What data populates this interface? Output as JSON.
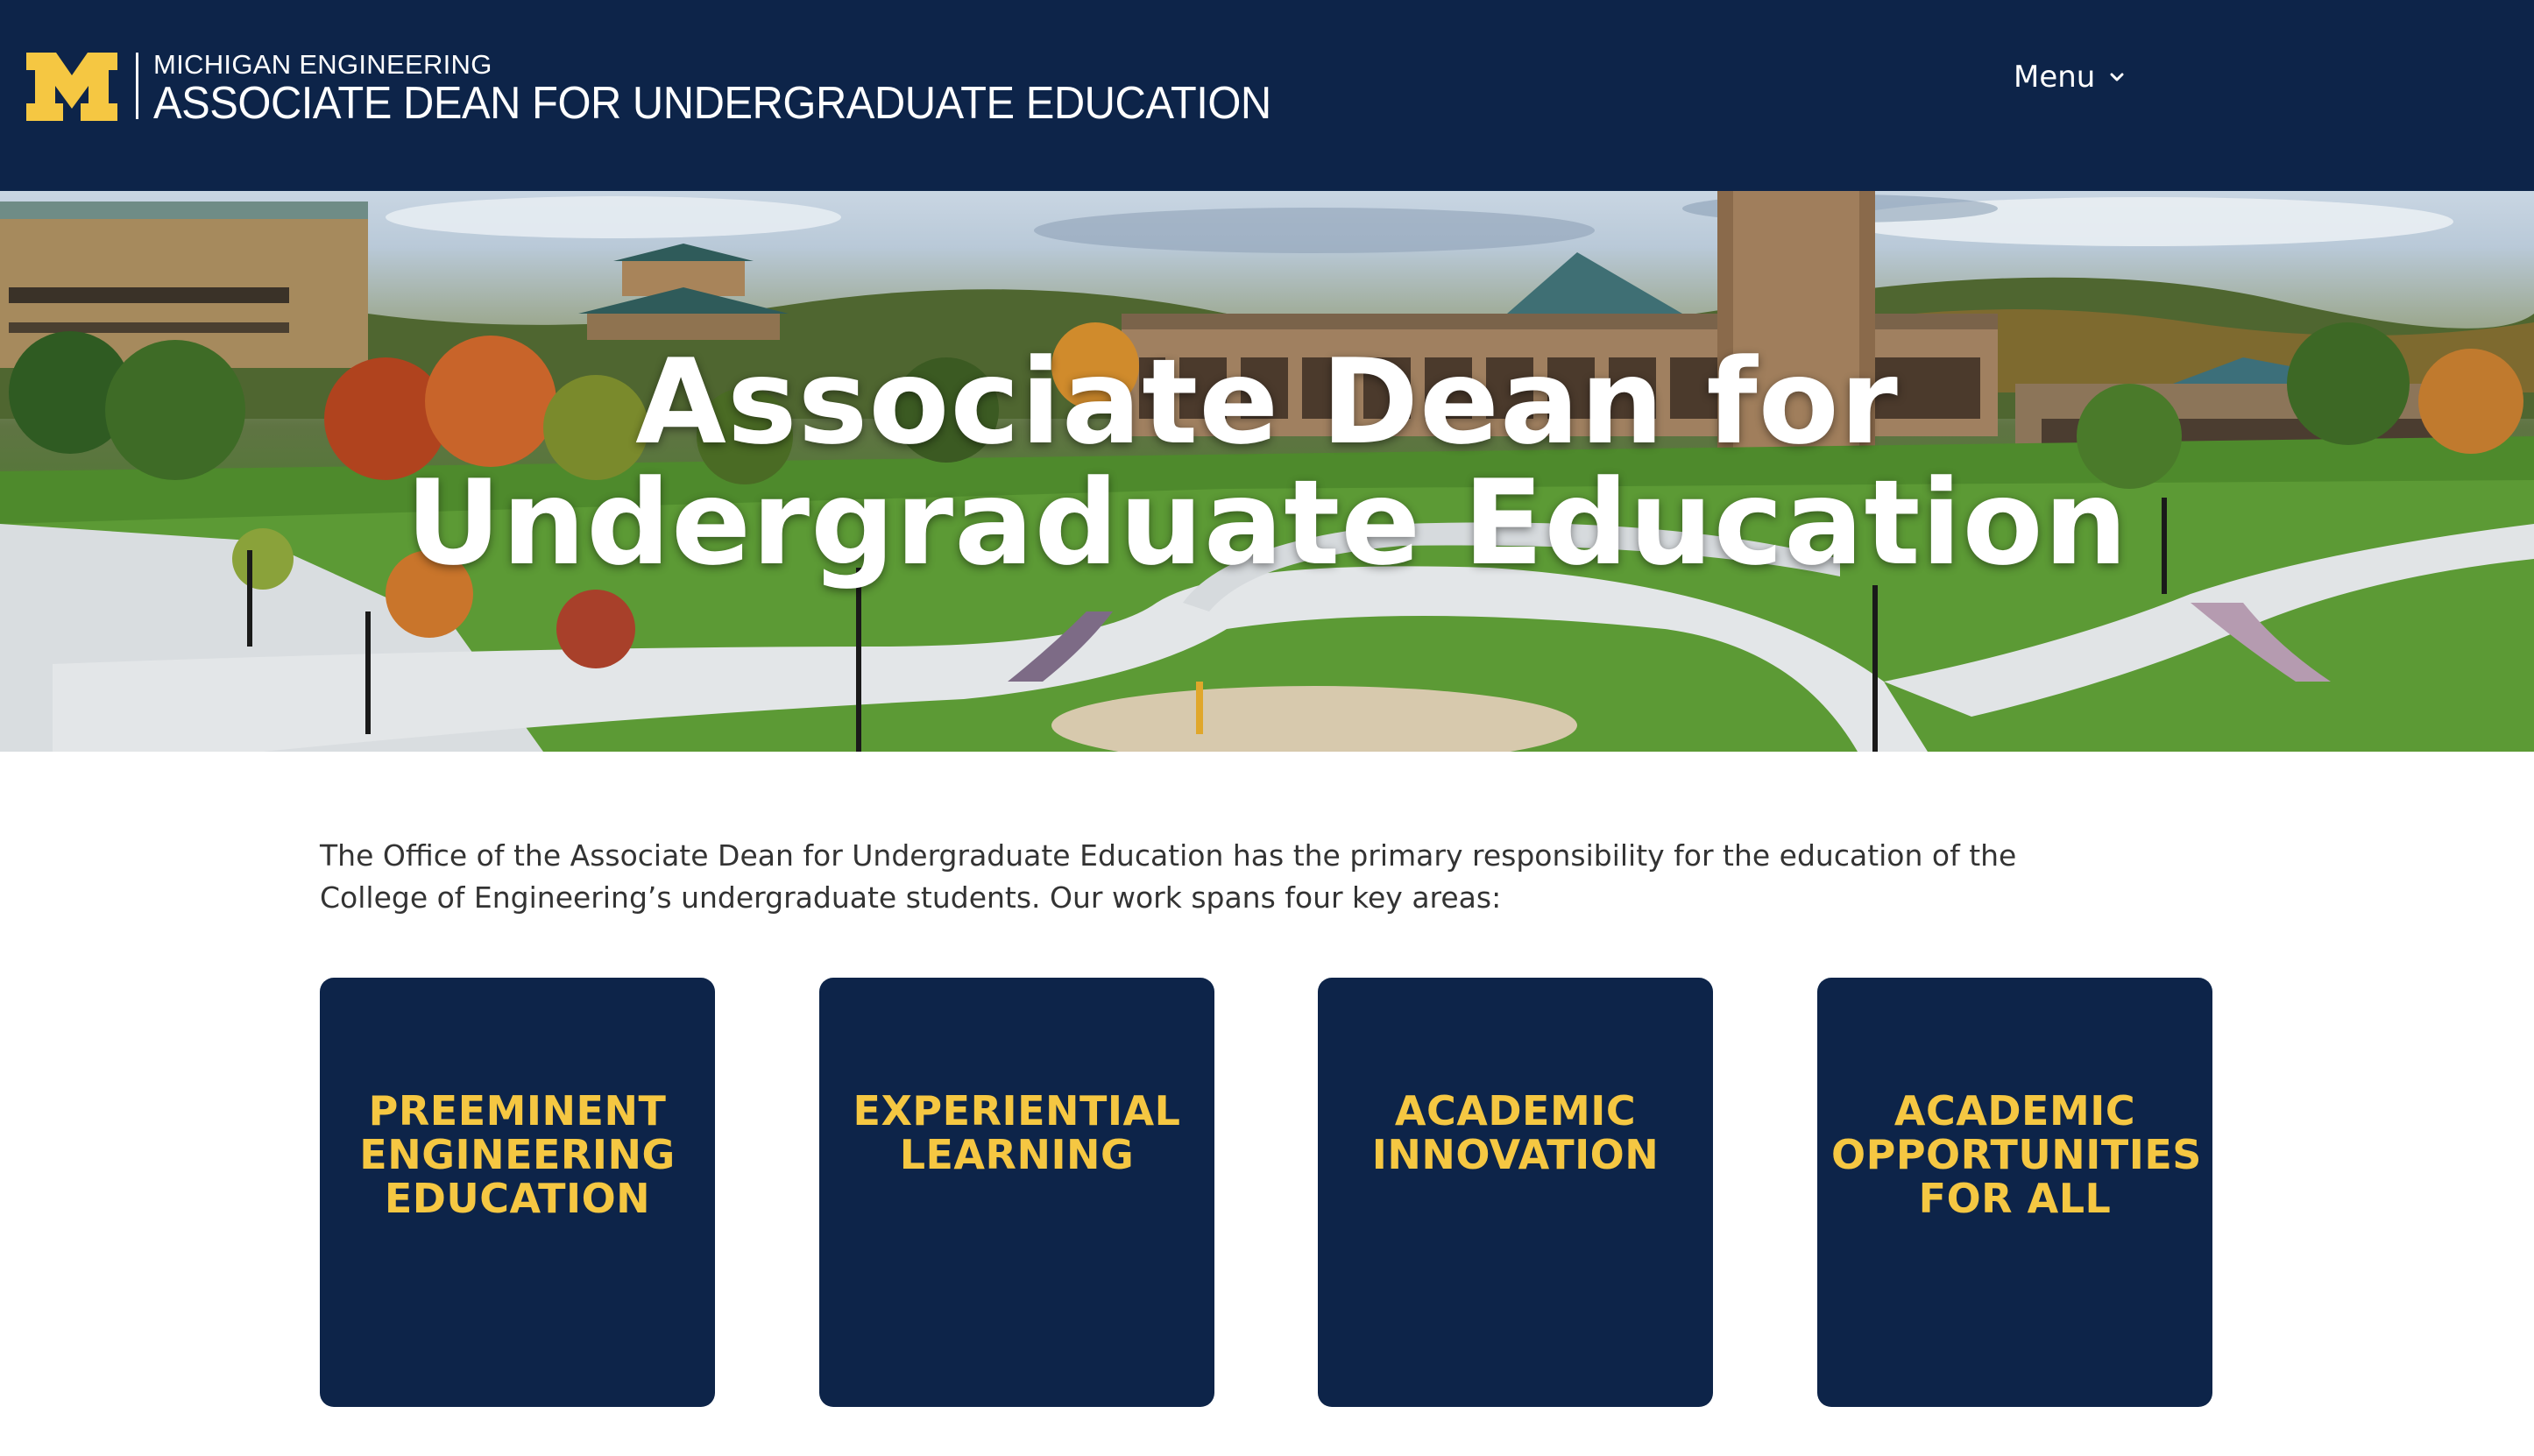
{
  "header": {
    "brand_small": "MICHIGAN ENGINEERING",
    "brand_large": "ASSOCIATE DEAN FOR UNDERGRADUATE EDUCATION",
    "menu_label": "Menu"
  },
  "hero": {
    "title_line_1": "Associate Dean for",
    "title_line_2": "Undergraduate Education"
  },
  "intro": {
    "text": "The Office of the Associate Dean for Undergraduate Education has the primary responsibility for the education of the College of Engineering’s undergraduate students. Our work spans four key areas:"
  },
  "cards": [
    {
      "lines": [
        "PREEMINENT",
        "ENGINEERING",
        "EDUCATION"
      ]
    },
    {
      "lines": [
        "EXPERIENTIAL",
        "LEARNING"
      ]
    },
    {
      "lines": [
        "ACADEMIC",
        "INNOVATION"
      ]
    },
    {
      "lines": [
        "ACADEMIC",
        "OPPORTUNITIES",
        "FOR ALL"
      ]
    }
  ],
  "colors": {
    "navy": "#0d2449",
    "maize": "#f5c742",
    "text": "#333333"
  },
  "icons": {
    "logo": "block-m-logo",
    "menu": "chevron-down-icon"
  }
}
